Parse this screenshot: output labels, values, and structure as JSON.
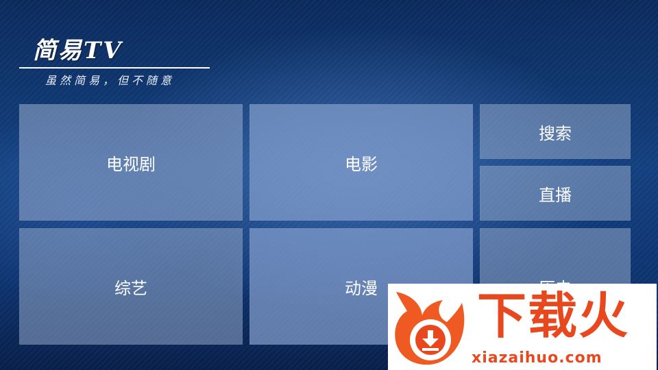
{
  "app": {
    "title": "简易TV",
    "slogan": "虽然简易，但不随意"
  },
  "tiles": {
    "tv_series": "电视剧",
    "movies": "电影",
    "search": "搜索",
    "live": "直播",
    "variety": "综艺",
    "anime": "动漫",
    "history": "历史"
  },
  "watermark": {
    "name": "下载火",
    "url": "xiazaihuo.com",
    "color": "#e8481e"
  }
}
